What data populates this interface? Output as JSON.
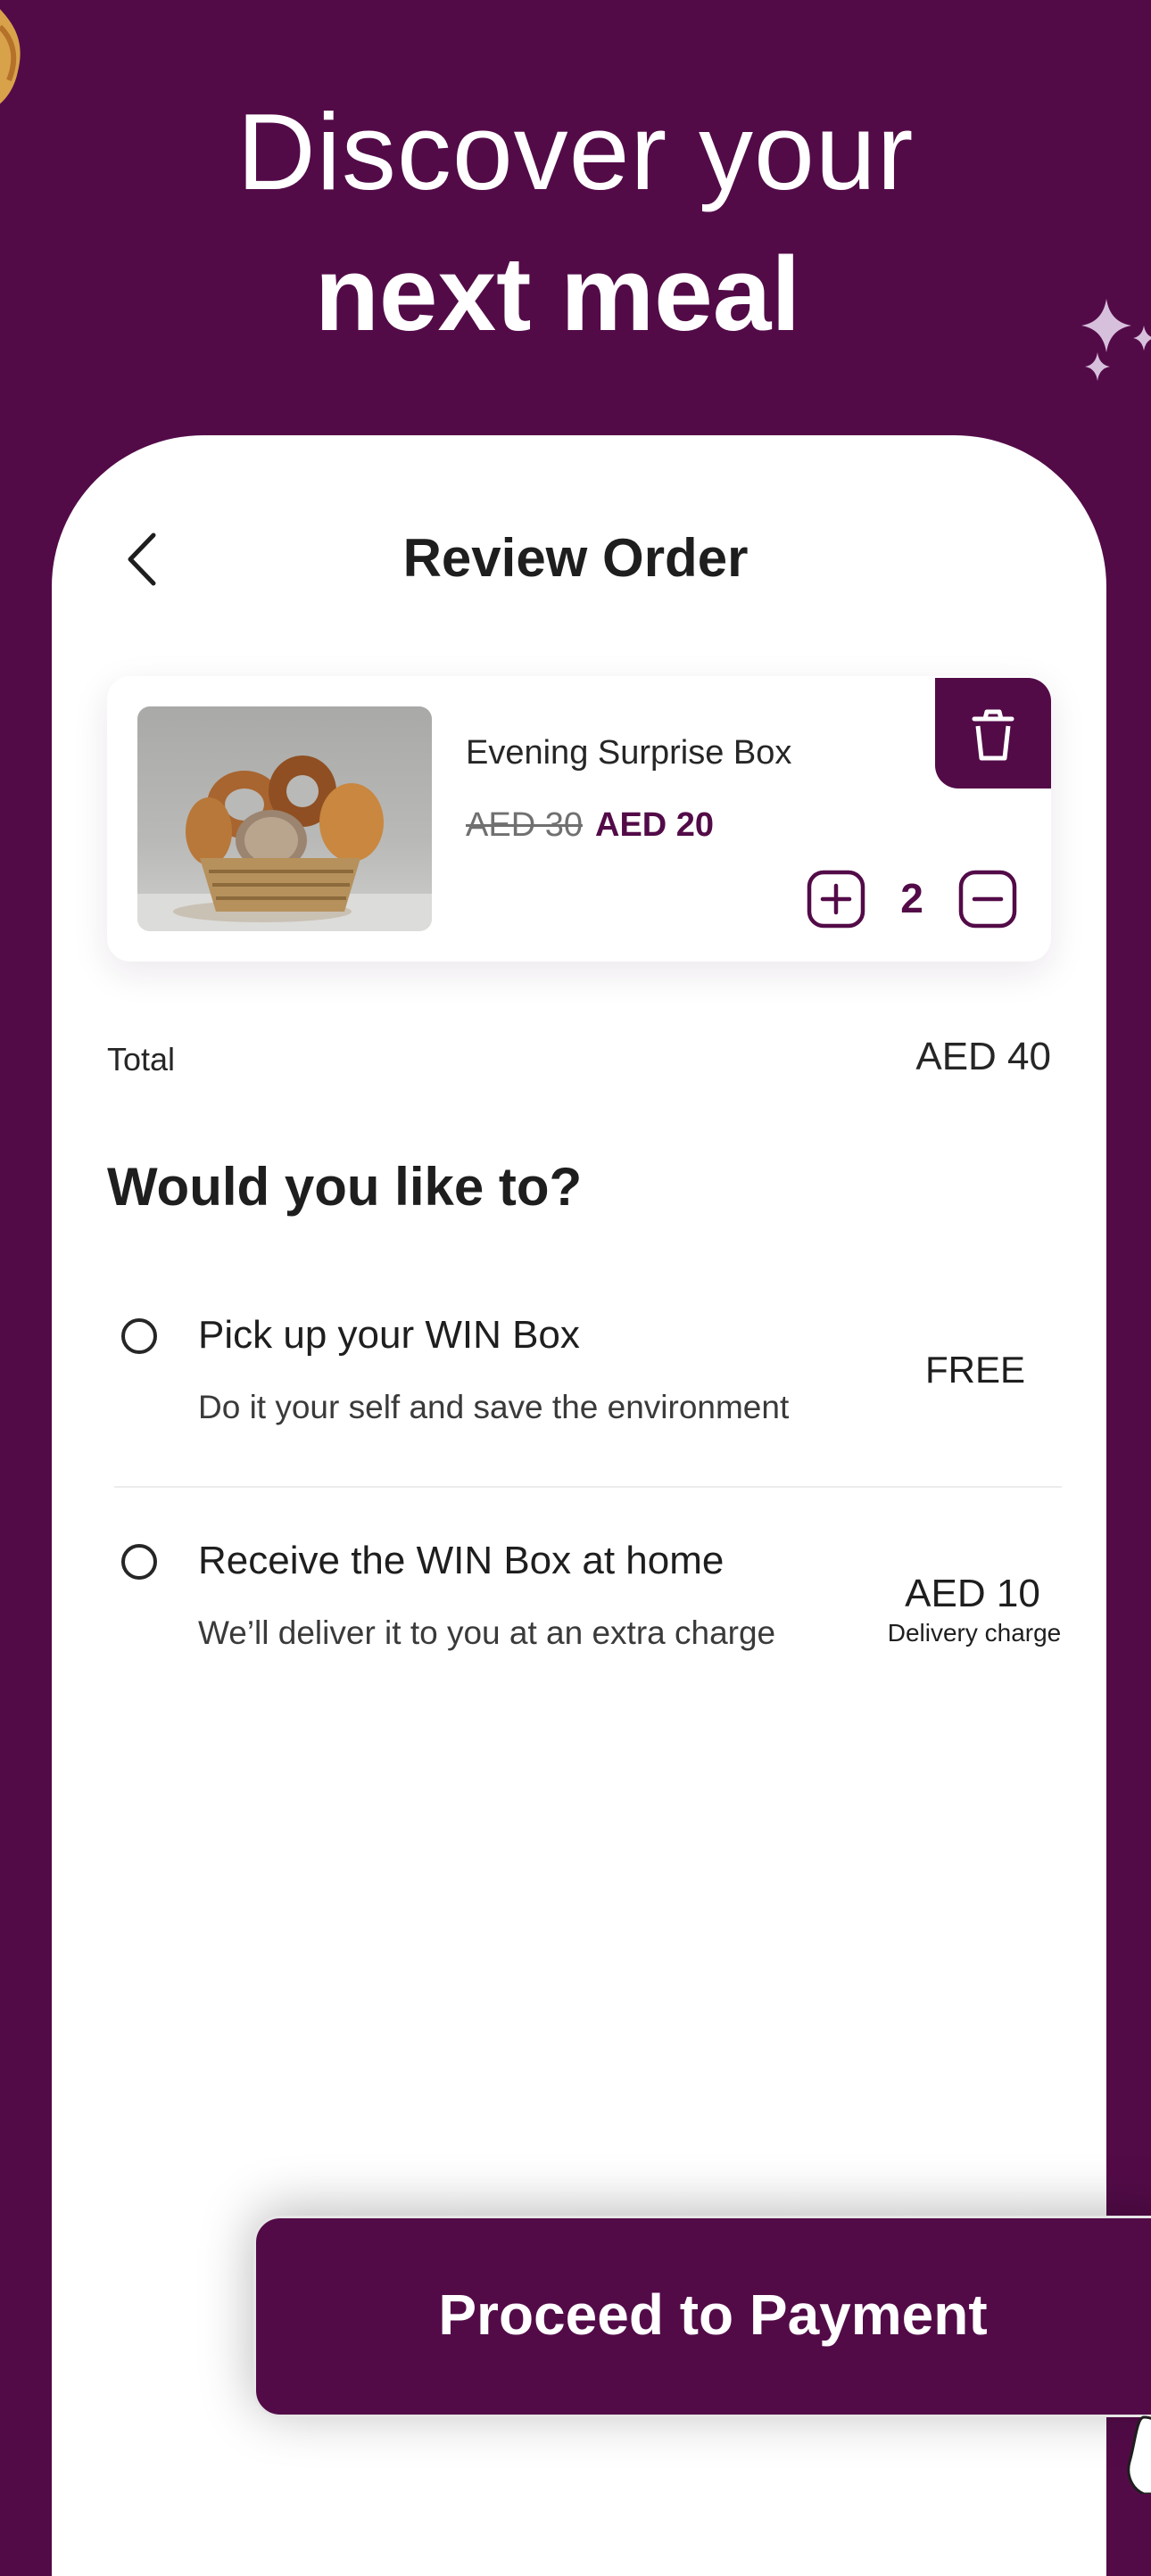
{
  "hero": {
    "line1": "Discover your",
    "line2": "next meal"
  },
  "header": {
    "title": "Review Order",
    "back_icon": "chevron-left-icon"
  },
  "cart_item": {
    "name": "Evening Surprise Box",
    "old_price": "AED 30",
    "new_price": "AED 20",
    "quantity": "2",
    "image": "bread-basket-photo",
    "delete_icon": "trash-icon",
    "plus_icon": "plus-icon",
    "minus_icon": "minus-icon"
  },
  "total": {
    "label": "Total",
    "value": "AED 40"
  },
  "delivery": {
    "heading": "Would you like to?",
    "options": [
      {
        "title": "Pick up your WIN Box",
        "subtitle": "Do it your self and save the environment",
        "price": "FREE",
        "note": ""
      },
      {
        "title": "Receive the WIN Box at home",
        "subtitle": "We’ll deliver it to you at an extra charge",
        "price": "AED 10",
        "note": "Delivery charge"
      }
    ]
  },
  "cta": {
    "label": "Proceed to Payment"
  },
  "colors": {
    "brand": "#530b48",
    "background": "#ffffff",
    "text": "#1e1e1e"
  }
}
